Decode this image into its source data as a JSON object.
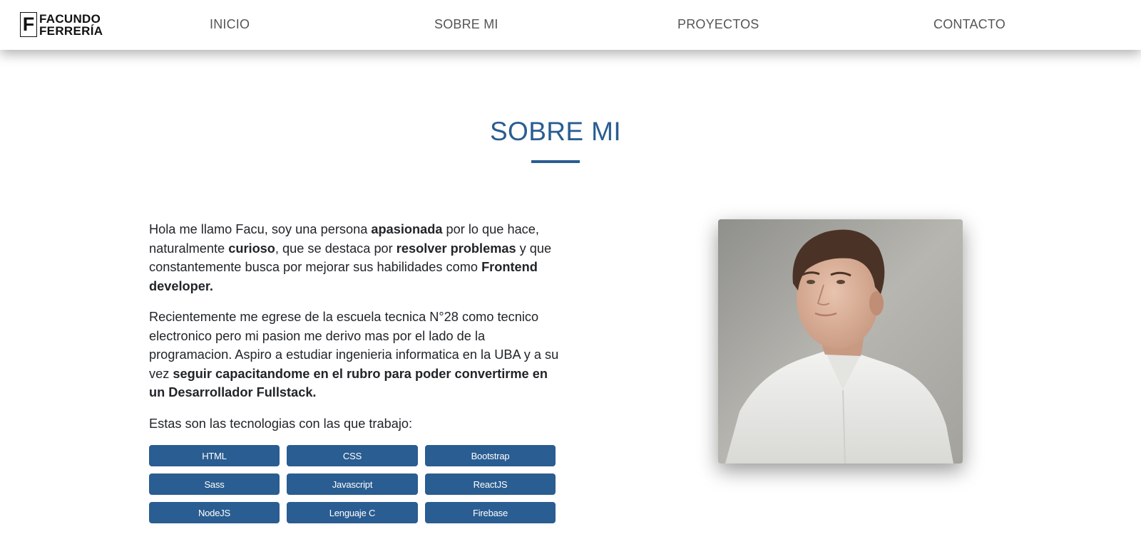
{
  "brand": {
    "letter": "F",
    "line1": "FACUNDO",
    "line2": "FERRERÍA"
  },
  "nav": {
    "inicio": "INICIO",
    "sobre_mi": "SOBRE MI",
    "proyectos": "PROYECTOS",
    "contacto": "CONTACTO"
  },
  "section": {
    "title": "SOBRE MI"
  },
  "paragraph1": {
    "t1": "Hola me llamo Facu, soy una persona ",
    "b1": "apasionada",
    "t2": " por lo que hace, naturalmente ",
    "b2": "curioso",
    "t3": ", que se destaca por ",
    "b3": "resolver problemas",
    "t4": " y que constantemente busca por mejorar sus habilidades como ",
    "b4": "Frontend developer."
  },
  "paragraph2": {
    "t1": "Recientemente me egrese de la escuela tecnica N°28 como tecnico electronico pero mi pasion me derivo mas por el lado de la programacion. Aspiro a estudiar ingenieria informatica en la UBA y a su vez ",
    "b1": "seguir capacitandome en el rubro para poder convertirme en un Desarrollador Fullstack."
  },
  "paragraph3": "Estas son las tecnologias con las que trabajo:",
  "technologies": [
    "HTML",
    "CSS",
    "Bootstrap",
    "Sass",
    "Javascript",
    "ReactJS",
    "NodeJS",
    "Lenguaje C",
    "Firebase"
  ],
  "colors": {
    "accent": "#2a5d91",
    "text": "#212529",
    "nav_text": "#555555"
  }
}
